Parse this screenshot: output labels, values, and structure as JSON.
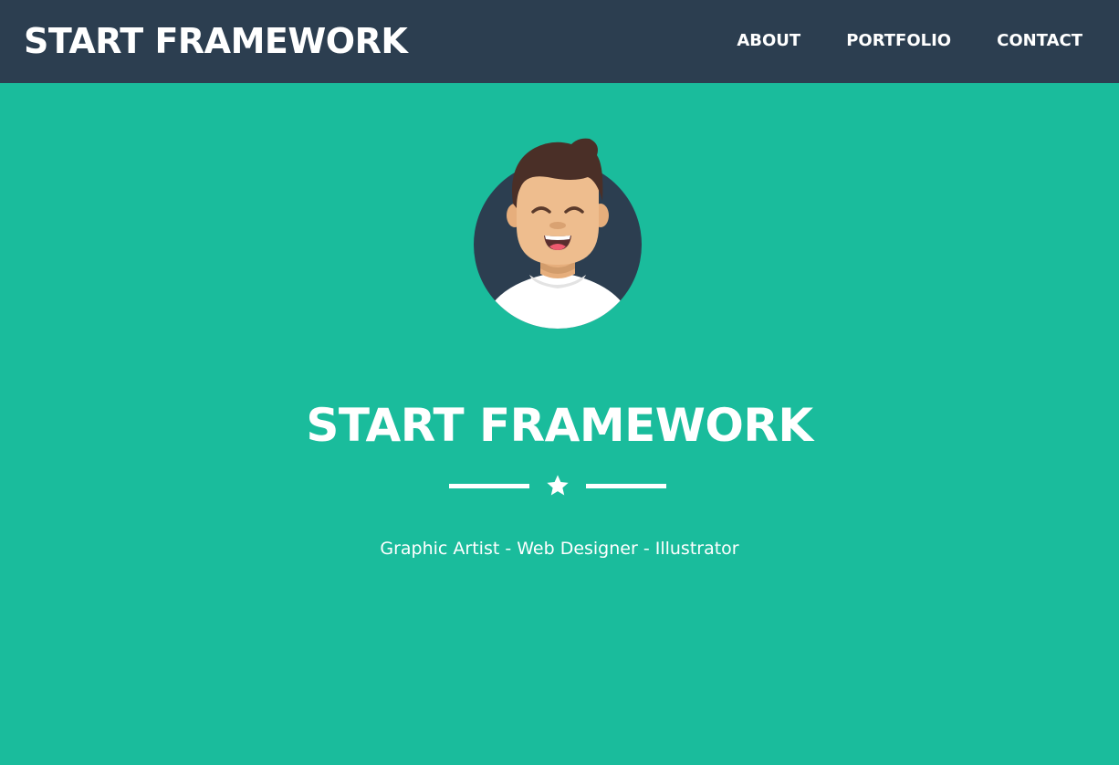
{
  "navbar": {
    "brand": "START FRAMEWORK",
    "links": [
      {
        "label": "ABOUT"
      },
      {
        "label": "PORTFOLIO"
      },
      {
        "label": "CONTACT"
      }
    ]
  },
  "hero": {
    "avatar_icon": "avatar-illustration",
    "title": "START FRAMEWORK",
    "divider_icon": "star-icon",
    "subtitle": "Graphic Artist - Web Designer - Illustrator"
  },
  "colors": {
    "navbar_bg": "#2c3e50",
    "hero_bg": "#1abc9c",
    "text": "#ffffff"
  }
}
